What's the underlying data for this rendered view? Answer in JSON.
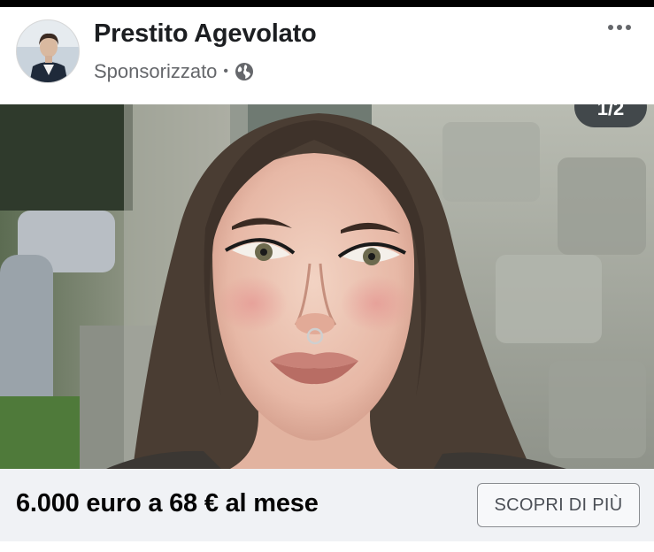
{
  "post": {
    "page_name": "Prestito Agevolato",
    "sponsored_label": "Sponsorizzato",
    "separator": "•",
    "audience_icon": "globe-icon",
    "menu_icon": "more-options-icon"
  },
  "media": {
    "counter": "1/2",
    "description_icon": "ad-photo"
  },
  "cta": {
    "headline": "6.000 euro a 68 € al mese",
    "button_label": "SCOPRI DI PIÙ"
  },
  "colors": {
    "title": "#1c1e21",
    "secondary": "#65676b",
    "cta_bar": "#f0f2f5",
    "button_border": "#8a8d91"
  }
}
